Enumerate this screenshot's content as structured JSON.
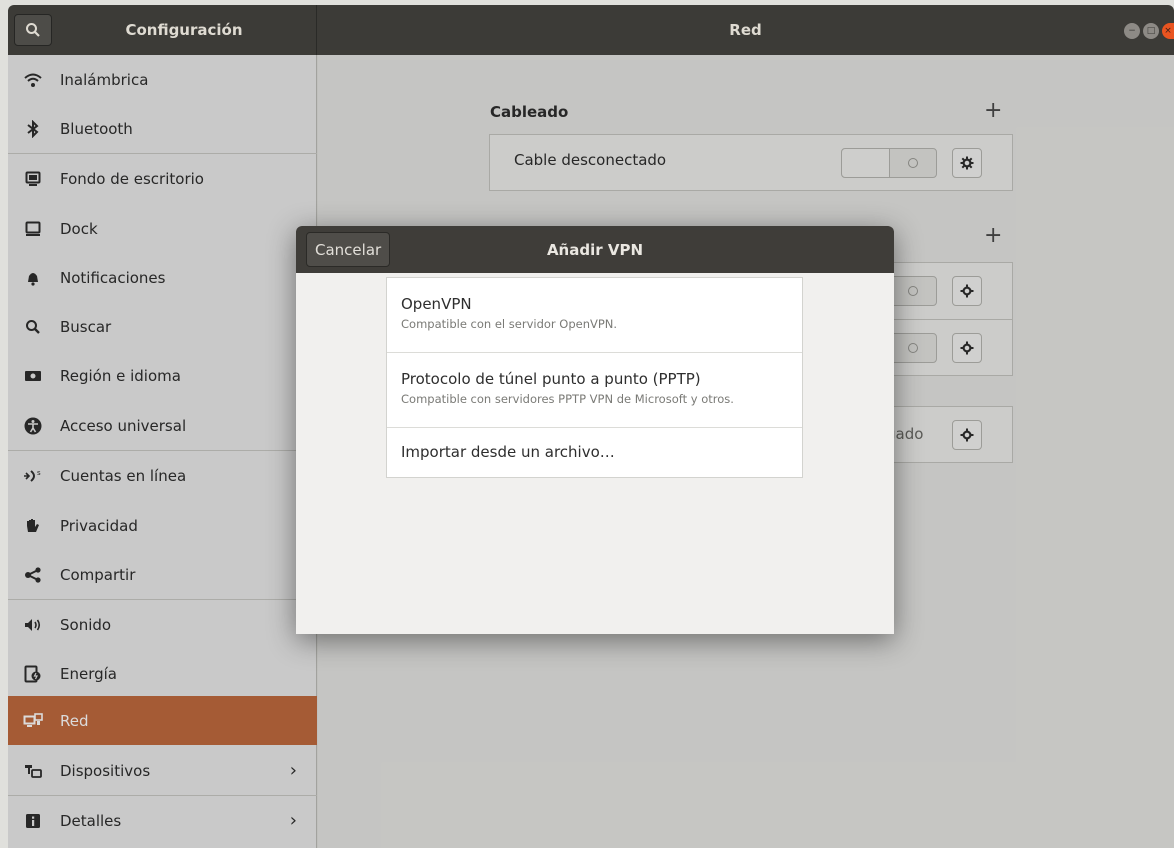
{
  "header": {
    "left_title": "Configuración",
    "right_title": "Red"
  },
  "sidebar": {
    "items": [
      {
        "label": "Inalámbrica",
        "icon": "wifi-icon"
      },
      {
        "label": "Bluetooth",
        "icon": "bluetooth-icon"
      },
      {
        "label": "Fondo de escritorio",
        "icon": "background-icon"
      },
      {
        "label": "Dock",
        "icon": "dock-icon"
      },
      {
        "label": "Notificaciones",
        "icon": "bell-icon"
      },
      {
        "label": "Buscar",
        "icon": "search-icon"
      },
      {
        "label": "Región e idioma",
        "icon": "region-icon"
      },
      {
        "label": "Acceso universal",
        "icon": "accessibility-icon"
      },
      {
        "label": "Cuentas en línea",
        "icon": "online-accounts-icon"
      },
      {
        "label": "Privacidad",
        "icon": "privacy-hand-icon"
      },
      {
        "label": "Compartir",
        "icon": "share-icon"
      },
      {
        "label": "Sonido",
        "icon": "speaker-icon"
      },
      {
        "label": "Energía",
        "icon": "power-icon"
      },
      {
        "label": "Red",
        "icon": "network-icon",
        "active": true
      },
      {
        "label": "Dispositivos",
        "icon": "devices-icon",
        "chevron": true
      },
      {
        "label": "Detalles",
        "icon": "info-icon",
        "chevron": true
      }
    ]
  },
  "main": {
    "wired": {
      "title": "Cableado",
      "plus": "+",
      "row_label": "Cable desconectado"
    },
    "vpn_plus": "+",
    "proxy_partial": "gado"
  },
  "dialog": {
    "title": "Añadir VPN",
    "cancel": "Cancelar",
    "options": [
      {
        "name": "OpenVPN",
        "desc": "Compatible con el servidor OpenVPN."
      },
      {
        "name": "Protocolo de túnel punto a punto (PPTP)",
        "desc": "Compatible con servidores PPTP VPN de Microsoft y otros."
      },
      {
        "name": "Importar desde un archivo…",
        "desc": ""
      }
    ]
  },
  "colors": {
    "accent": "#c06a3e",
    "headerbar": "#3c3b37",
    "close": "#e95420"
  }
}
